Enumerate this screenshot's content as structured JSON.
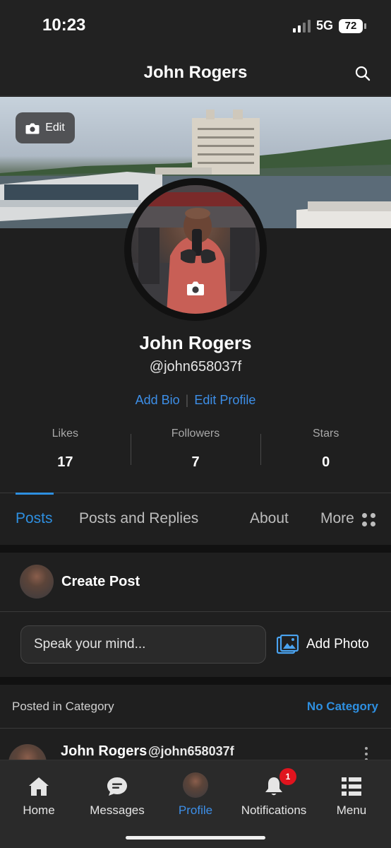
{
  "status_bar": {
    "time": "10:23",
    "network": "5G",
    "battery": "72"
  },
  "header": {
    "title": "John Rogers",
    "search_icon": "search-icon"
  },
  "cover": {
    "edit_label": "Edit"
  },
  "profile": {
    "name": "John Rogers",
    "handle": "@john658037f",
    "add_bio": "Add Bio",
    "edit_profile": "Edit Profile",
    "link_separator": "|"
  },
  "stats": [
    {
      "label": "Likes",
      "value": "17"
    },
    {
      "label": "Followers",
      "value": "7"
    },
    {
      "label": "Stars",
      "value": "0"
    }
  ],
  "tabs": [
    "Posts",
    "Posts and Replies",
    "About",
    "More"
  ],
  "create_post": {
    "title": "Create Post",
    "placeholder": "Speak your mind...",
    "add_photo": "Add Photo"
  },
  "category": {
    "label": "Posted in Category",
    "value": "No Category"
  },
  "post": {
    "author": "John Rogers",
    "handle": "@john658037f"
  },
  "nav": {
    "items": [
      "Home",
      "Messages",
      "Profile",
      "Notifications",
      "Menu"
    ],
    "notifications_badge": "1"
  },
  "colors": {
    "accent": "#2e8fe0",
    "link": "#3d8fe8",
    "badge": "#e0141e",
    "background": "#1f1f1f"
  }
}
